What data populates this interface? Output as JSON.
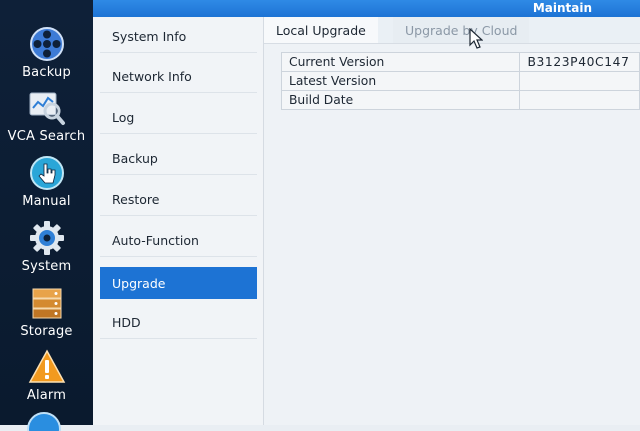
{
  "topbar": {
    "title": "Maintain"
  },
  "rail": {
    "items": [
      {
        "label": "Backup",
        "icon": "film-reel-icon"
      },
      {
        "label": "VCA Search",
        "icon": "magnifier-chart-icon"
      },
      {
        "label": "Manual",
        "icon": "hand-pointer-icon"
      },
      {
        "label": "System",
        "icon": "gear-icon"
      },
      {
        "label": "Storage",
        "icon": "storage-disk-icon"
      },
      {
        "label": "Alarm",
        "icon": "warning-icon"
      }
    ]
  },
  "submenu": {
    "items": [
      {
        "label": "System Info"
      },
      {
        "label": "Network Info"
      },
      {
        "label": "Log"
      },
      {
        "label": "Backup"
      },
      {
        "label": "Restore"
      },
      {
        "label": "Auto-Function"
      },
      {
        "label": "Upgrade",
        "active": true
      },
      {
        "label": "HDD"
      }
    ]
  },
  "tabs": {
    "local": "Local Upgrade",
    "cloud": "Upgrade by Cloud"
  },
  "info": {
    "current_version_label": "Current Version",
    "current_version_value": "B3123P40C147",
    "latest_version_label": "Latest Version",
    "latest_version_value": "",
    "build_date_label": "Build Date",
    "build_date_value": ""
  },
  "colors": {
    "accent": "#1d73d4",
    "rail": "#0e2038",
    "alarm": "#f29a1f"
  }
}
